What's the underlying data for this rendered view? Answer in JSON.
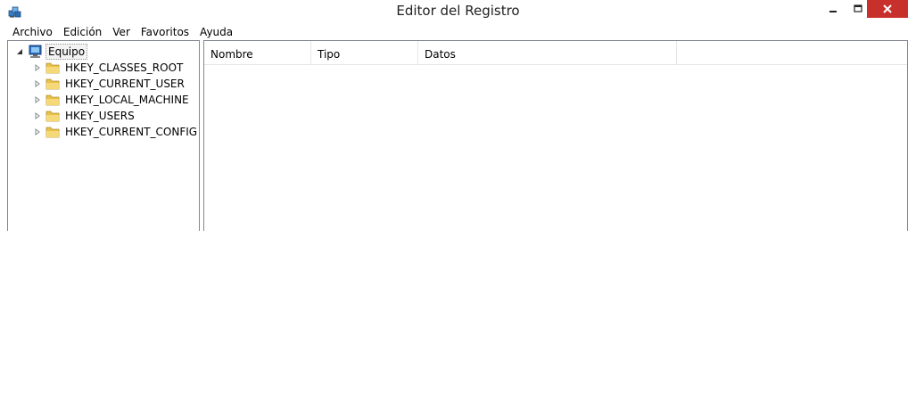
{
  "window": {
    "title": "Editor del Registro"
  },
  "menu": [
    {
      "label": "Archivo"
    },
    {
      "label": "Edición"
    },
    {
      "label": "Ver"
    },
    {
      "label": "Favoritos"
    },
    {
      "label": "Ayuda"
    }
  ],
  "tree": {
    "root": {
      "label": "Equipo",
      "icon": "computer-icon",
      "expanded": true
    },
    "keys": [
      {
        "label": "HKEY_CLASSES_ROOT",
        "icon": "folder-icon"
      },
      {
        "label": "HKEY_CURRENT_USER",
        "icon": "folder-icon"
      },
      {
        "label": "HKEY_LOCAL_MACHINE",
        "icon": "folder-icon"
      },
      {
        "label": "HKEY_USERS",
        "icon": "folder-icon"
      },
      {
        "label": "HKEY_CURRENT_CONFIG",
        "icon": "folder-icon"
      }
    ]
  },
  "list": {
    "columns": [
      {
        "label": "Nombre"
      },
      {
        "label": "Tipo"
      },
      {
        "label": "Datos"
      }
    ],
    "rows": []
  },
  "colors": {
    "close_button": "#c7302b",
    "folder": "#e8c14a",
    "border": "#828790"
  }
}
